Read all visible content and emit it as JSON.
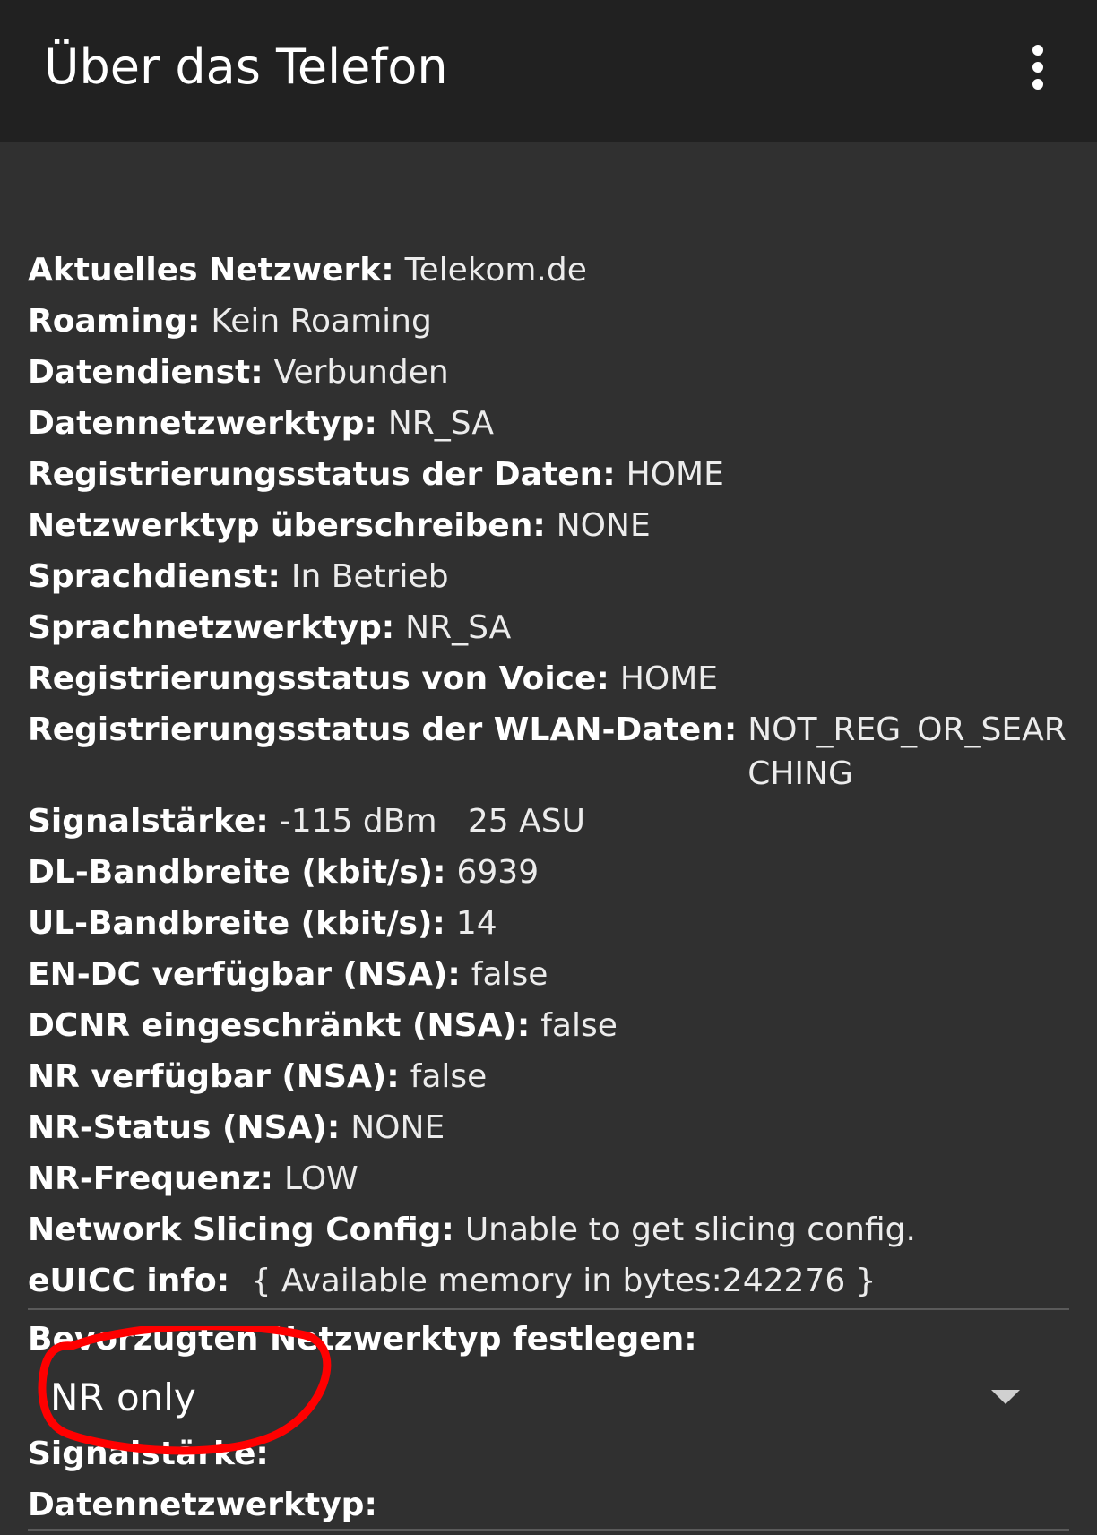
{
  "appbar": {
    "title": "Über das Telefon",
    "menu_icon": "more-vert-icon"
  },
  "info_rows": [
    {
      "label": "Aktuelles Netzwerk:",
      "value": "Telekom.de"
    },
    {
      "label": "Roaming:",
      "value": "Kein Roaming"
    },
    {
      "label": "Datendienst:",
      "value": "Verbunden"
    },
    {
      "label": "Datennetzwerktyp:",
      "value": "NR_SA"
    },
    {
      "label": "Registrierungsstatus der Daten:",
      "value": "HOME"
    },
    {
      "label": "Netzwerktyp überschreiben:",
      "value": "NONE"
    },
    {
      "label": "Sprachdienst:",
      "value": "In Betrieb"
    },
    {
      "label": "Sprachnetzwerktyp:",
      "value": "NR_SA"
    },
    {
      "label": "Registrierungsstatus von Voice:",
      "value": "HOME"
    },
    {
      "label": "Registrierungsstatus der WLAN-Daten:",
      "value": "NOT_REG_OR_SEARCHING"
    },
    {
      "label": "Signalstärke:",
      "value": "-115 dBm   25 ASU"
    },
    {
      "label": "DL-Bandbreite (kbit/s):",
      "value": "6939"
    },
    {
      "label": "UL-Bandbreite (kbit/s):",
      "value": "14"
    },
    {
      "label": "EN-DC verfügbar (NSA):",
      "value": "false"
    },
    {
      "label": "DCNR eingeschränkt (NSA):",
      "value": "false"
    },
    {
      "label": "NR verfügbar (NSA):",
      "value": "false"
    },
    {
      "label": "NR-Status (NSA):",
      "value": "NONE"
    },
    {
      "label": "NR-Frequenz:",
      "value": "LOW"
    },
    {
      "label": "Network Slicing Config:",
      "value": "Unable to get slicing config."
    },
    {
      "label": "eUICC info:",
      "value": " { Available memory in bytes:242276 }"
    }
  ],
  "preferred_network": {
    "label": "Bevorzugten Netzwerktyp festlegen:",
    "selected": "NR only",
    "dropdown_icon": "dropdown-arrow-icon"
  },
  "bottom_rows": [
    {
      "label": "Signalstärke:"
    },
    {
      "label": "Datennetzwerktyp:"
    }
  ],
  "colors": {
    "background": "#303030",
    "appbar": "#212121",
    "annotation": "#ff0000"
  }
}
